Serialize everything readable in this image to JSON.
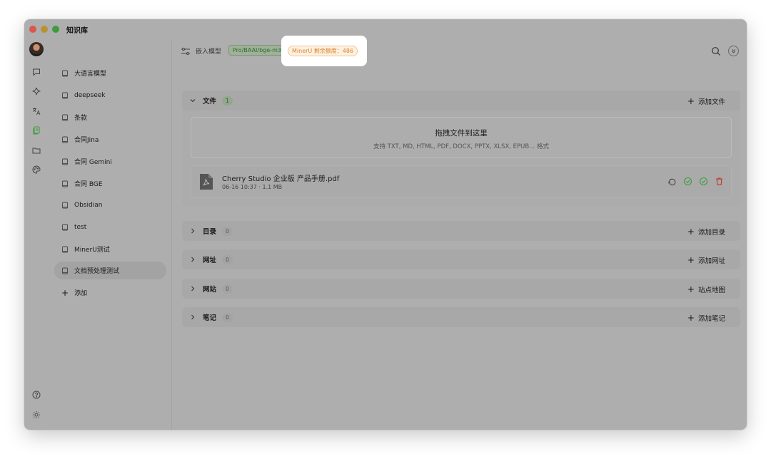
{
  "window": {
    "title": "知识库"
  },
  "colors": {
    "accent_green": "#3e9c3f",
    "mineru_orange": "#d9822b",
    "delete_red": "#c0392b"
  },
  "iconbar": {
    "icons": [
      "avatar",
      "chat-icon",
      "sparkle-icon",
      "translate-icon",
      "knowledge-icon",
      "folder-icon",
      "palette-icon",
      "help-icon",
      "theme-icon",
      "settings-icon"
    ]
  },
  "knowledge_bases": {
    "items": [
      {
        "label": "大语言模型"
      },
      {
        "label": "deepseek"
      },
      {
        "label": "条款"
      },
      {
        "label": "合同Jina"
      },
      {
        "label": "合同 Gemini"
      },
      {
        "label": "合同 BGE"
      },
      {
        "label": "Obsidian"
      },
      {
        "label": "test"
      },
      {
        "label": "MinerU测试"
      },
      {
        "label": "文档预处理测试",
        "active": true
      }
    ],
    "add_label": "添加"
  },
  "toolbar": {
    "embed_label": "嵌入模型",
    "model_tag": "Pro/BAAI/bge-m3",
    "mineru_tag": "MinerU 剩余额度：486"
  },
  "sections": {
    "files": {
      "title": "文件",
      "count": "1",
      "add_label": "添加文件"
    },
    "directory": {
      "title": "目录",
      "count": "0",
      "add_label": "添加目录"
    },
    "urls": {
      "title": "网址",
      "count": "0",
      "add_label": "添加网址"
    },
    "sites": {
      "title": "网站",
      "count": "0",
      "add_label": "站点地图"
    },
    "notes": {
      "title": "笔记",
      "count": "0",
      "add_label": "添加笔记"
    }
  },
  "dropzone": {
    "title": "拖拽文件到这里",
    "subtitle": "支持 TXT, MD, HTML, PDF, DOCX, PPTX, XLSX, EPUB... 格式"
  },
  "file": {
    "name": "Cherry Studio 企业版 产品手册.pdf",
    "meta": "06-16 10:37 · 1.1 MB"
  }
}
